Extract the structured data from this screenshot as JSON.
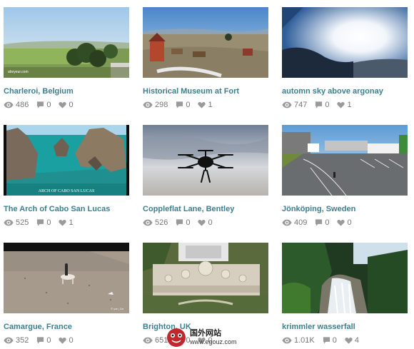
{
  "videos": [
    {
      "title": "Charleroi, Belgium",
      "views": "486",
      "comments": "0",
      "likes": "0",
      "overlay": "aboyeur.com"
    },
    {
      "title": "Historical Museum at Fort",
      "views": "298",
      "comments": "0",
      "likes": "1"
    },
    {
      "title": "automn sky above argonay",
      "views": "747",
      "comments": "0",
      "likes": "1"
    },
    {
      "title": "The Arch of Cabo San Lucas",
      "views": "525",
      "comments": "0",
      "likes": "1",
      "overlay": "ARCH OF CABO SAN LUCAS"
    },
    {
      "title": "Coppleflat Lane, Bentley",
      "views": "526",
      "comments": "0",
      "likes": "0"
    },
    {
      "title": "Jönköping, Sweden",
      "views": "409",
      "comments": "0",
      "likes": "0"
    },
    {
      "title": "Camargue, France",
      "views": "352",
      "comments": "0",
      "likes": "0",
      "overlay": "© yan_Da"
    },
    {
      "title": "Brighton, UK",
      "views": "651",
      "comments": "0",
      "likes": "0"
    },
    {
      "title": "krimmler wasserfall",
      "views": "1.01K",
      "comments": "0",
      "likes": "4"
    }
  ],
  "watermark": {
    "name": "国外网站",
    "url": "www.egouz.com"
  },
  "colors": {
    "title": "#3c7f8f",
    "stat_text": "#777777",
    "icon": "#9a9a9a"
  },
  "icons": {
    "views": "eye-icon",
    "comments": "comment-icon",
    "likes": "heart-icon"
  }
}
